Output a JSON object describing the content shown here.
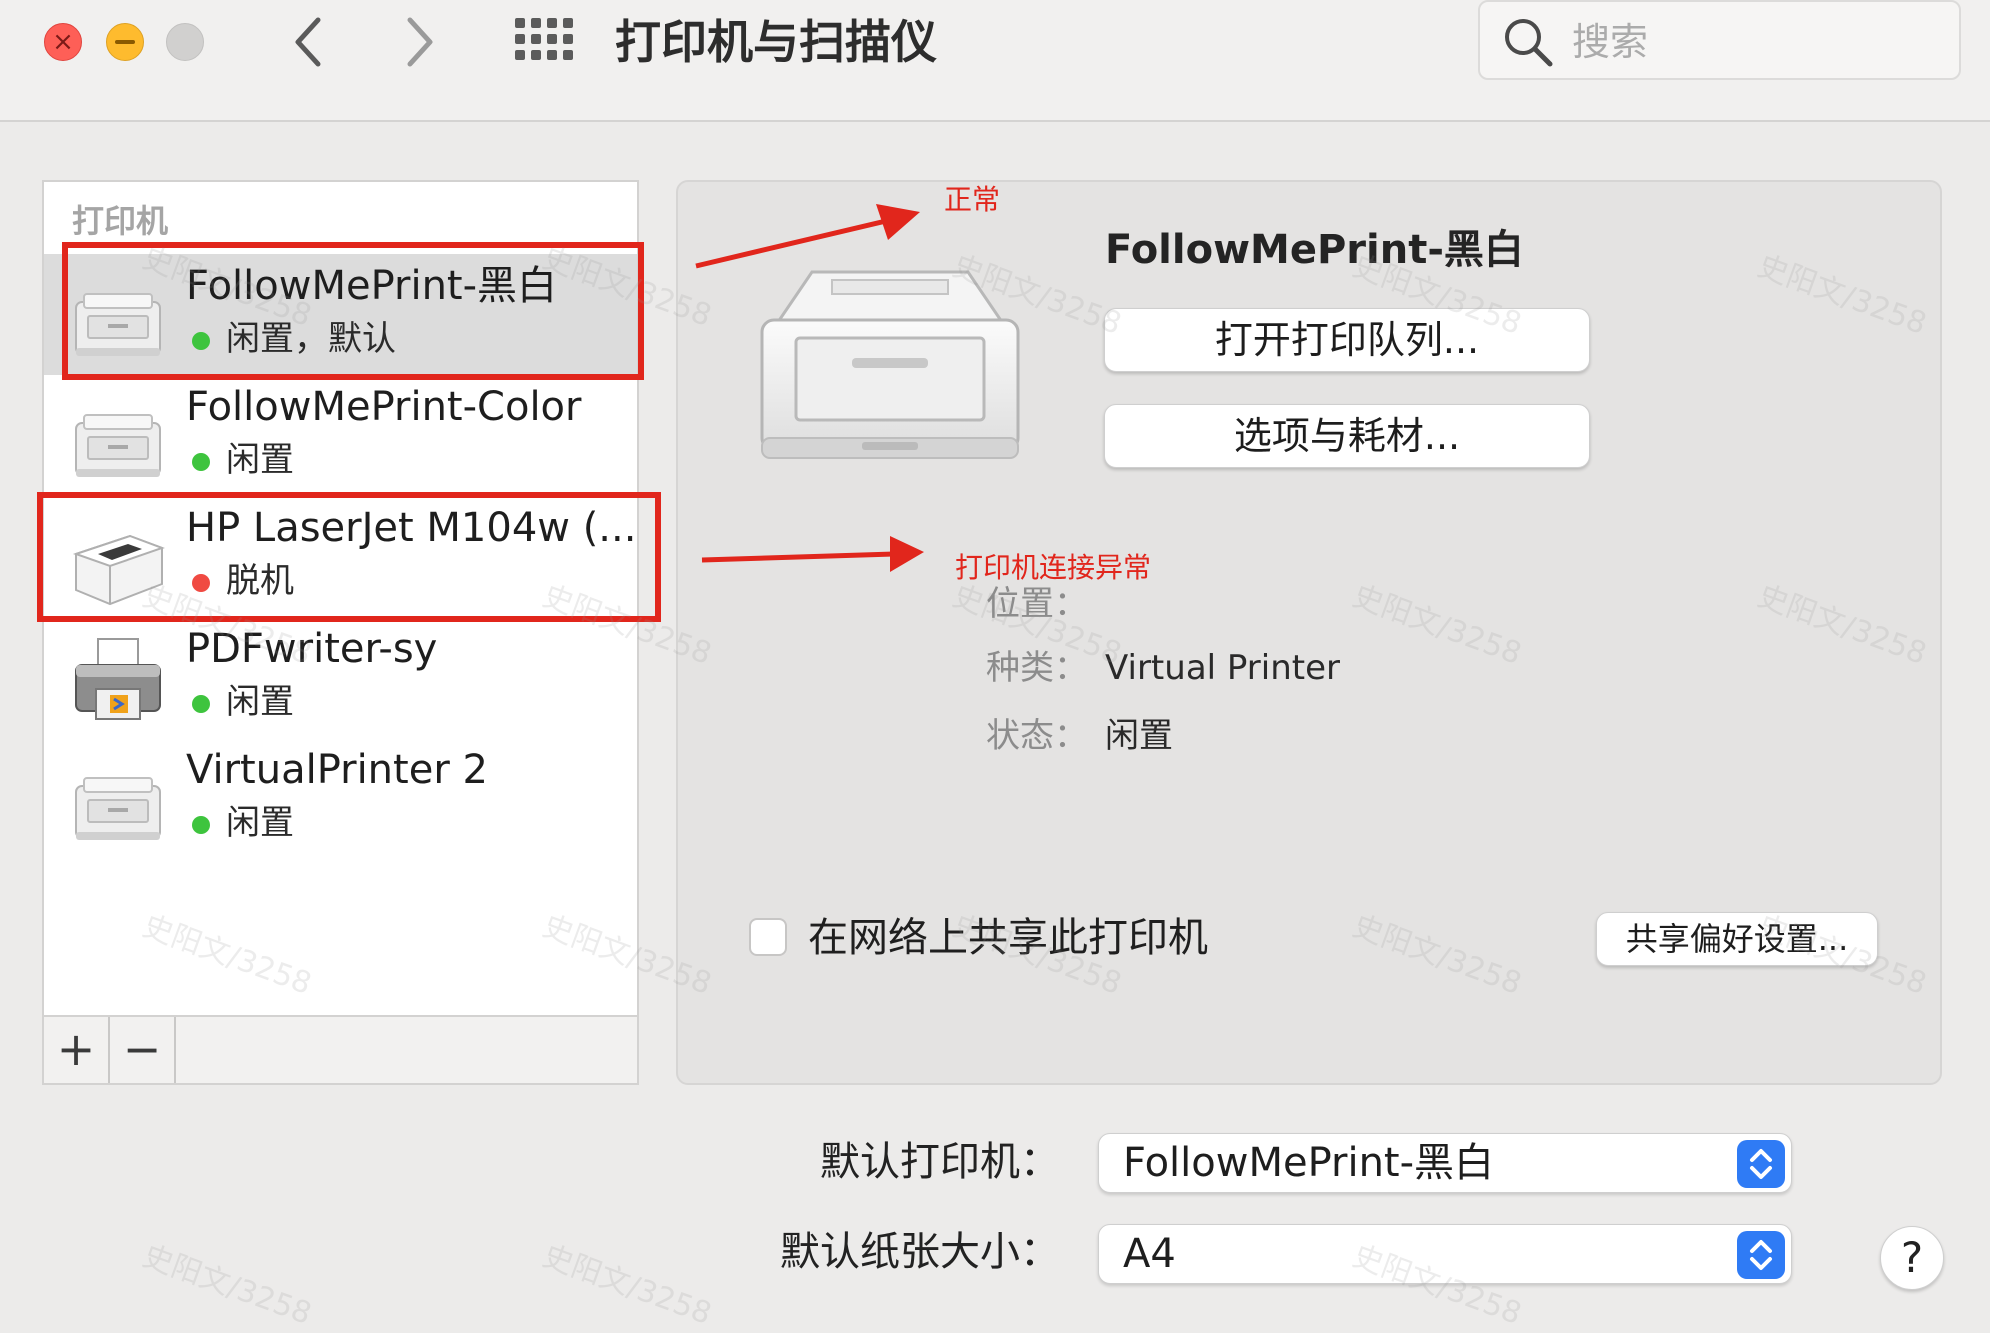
{
  "window": {
    "title": "打印机与扫描仪"
  },
  "search": {
    "placeholder": "搜索"
  },
  "printer_list": {
    "header": "打印机",
    "items": [
      {
        "name": "FollowMePrint-黑白",
        "status": "闲置，默认",
        "status_color": "green",
        "icon": "laser-printer-icon"
      },
      {
        "name": "FollowMePrint-Color",
        "status": "闲置",
        "status_color": "green",
        "icon": "laser-printer-icon"
      },
      {
        "name": "HP LaserJet M104w (...",
        "status": "脱机",
        "status_color": "red",
        "icon": "hp-printer-icon"
      },
      {
        "name": "PDFwriter-sy",
        "status": "闲置",
        "status_color": "green",
        "icon": "pdf-printer-icon"
      },
      {
        "name": "VirtualPrinter 2",
        "status": "闲置",
        "status_color": "green",
        "icon": "laser-printer-icon"
      }
    ],
    "add_label": "+",
    "remove_label": "−"
  },
  "detail": {
    "printer_name": "FollowMePrint-黑白",
    "open_queue_label": "打开打印队列...",
    "options_label": "选项与耗材...",
    "location_label": "位置：",
    "location_value": "",
    "kind_label": "种类：",
    "kind_value": "Virtual Printer",
    "status_label": "状态：",
    "status_value": "闲置",
    "share_label": "在网络上共享此打印机",
    "share_checked": false,
    "share_prefs_label": "共享偏好设置..."
  },
  "defaults": {
    "default_printer_label": "默认打印机：",
    "default_printer_value": "FollowMePrint-黑白",
    "paper_size_label": "默认纸张大小：",
    "paper_size_value": "A4",
    "help_label": "?"
  },
  "annotations": {
    "normal": "正常",
    "connection_error": "打印机连接异常",
    "color": "#e1261c"
  },
  "watermark": "史阳文/3258",
  "colors": {
    "status_green": "#3ec43e",
    "status_red": "#f04a42",
    "accent_blue": "#2f7bf5",
    "close": "#fe5f57",
    "minimize": "#febb2e"
  }
}
